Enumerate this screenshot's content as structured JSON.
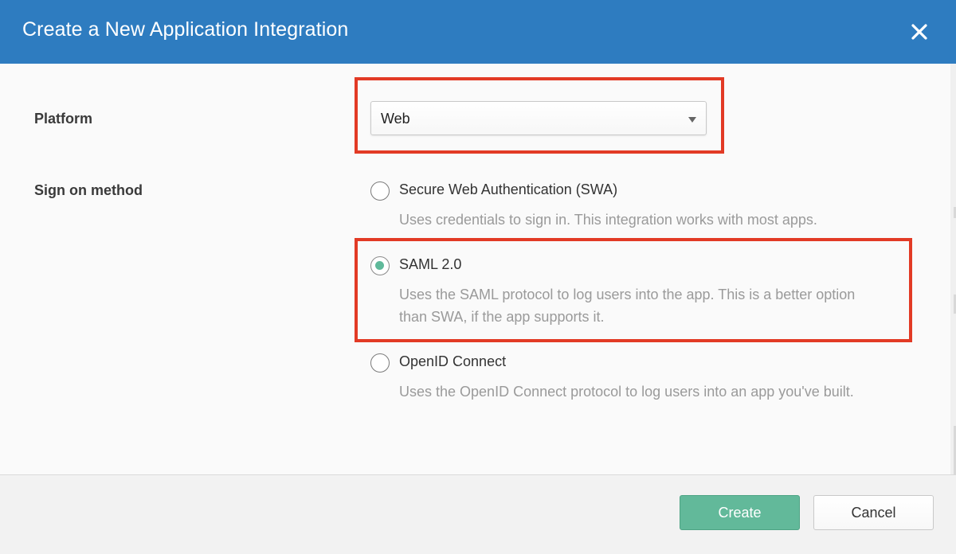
{
  "dialog": {
    "title": "Create a New Application Integration",
    "close_icon": "close-icon"
  },
  "platform": {
    "label": "Platform",
    "selected": "Web"
  },
  "sign_on": {
    "label": "Sign on method",
    "options": [
      {
        "label": "Secure Web Authentication (SWA)",
        "description": "Uses credentials to sign in. This integration works with most apps.",
        "selected": false
      },
      {
        "label": "SAML 2.0",
        "description_line1": "Uses the SAML protocol to log users into the app. This is a better option",
        "description_line2": "than SWA, if the app supports it.",
        "selected": true
      },
      {
        "label": "OpenID Connect",
        "description": "Uses the OpenID Connect protocol to log users into an app you've built.",
        "selected": false
      }
    ]
  },
  "footer": {
    "create_label": "Create",
    "cancel_label": "Cancel"
  },
  "colors": {
    "header": "#2e7cc0",
    "accent_green": "#62b99a",
    "highlight_red": "#e23a25"
  }
}
